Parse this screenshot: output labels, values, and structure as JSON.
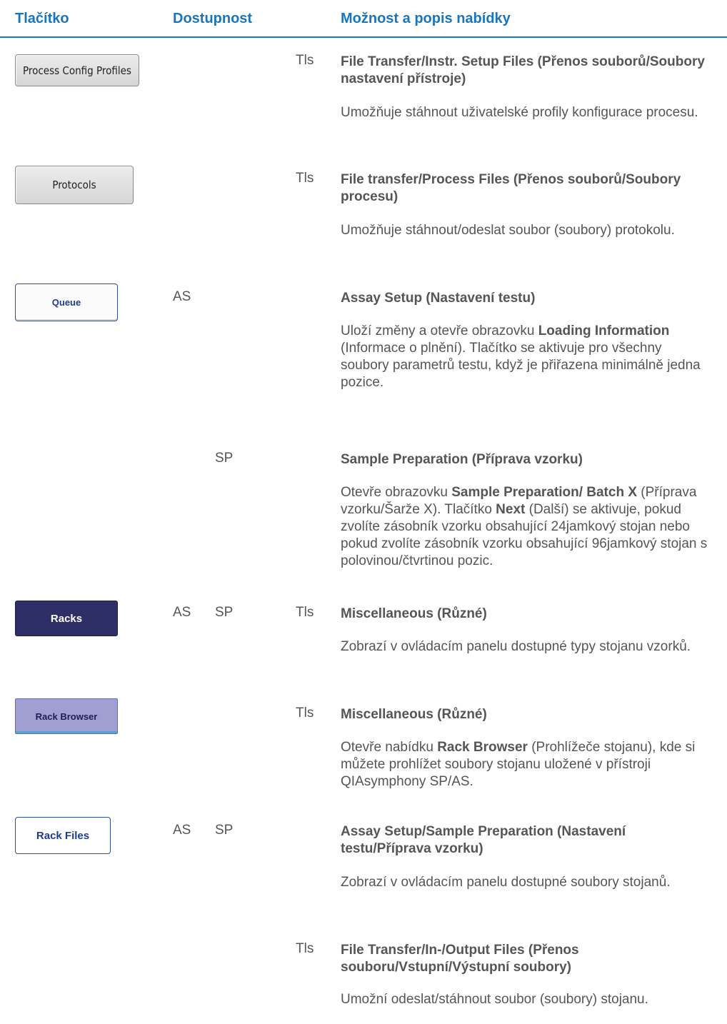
{
  "header": {
    "col_button": "Tlačítko",
    "col_availability": "Dostupnost",
    "col_description": "Možnost a popis nabídky"
  },
  "colors": {
    "accent": "#1a75bc",
    "text": "#555555"
  },
  "entries": [
    {
      "button_label": "Process Config Profiles",
      "button_style": "gray",
      "as": "",
      "sp": "",
      "tls": "Tls",
      "title": "File Transfer/Instr. Setup Files (Přenos souborů/Soubory nastavení přístroje)",
      "description": "Umožňuje stáhnout uživatelské profily konfigurace procesu."
    },
    {
      "button_label": "Protocols",
      "button_style": "gray",
      "as": "",
      "sp": "",
      "tls": "Tls",
      "title": "File transfer/Process Files (Přenos souborů/Soubory procesu)",
      "description": "Umožňuje stáhnout/odeslat soubor (soubory) protokolu."
    },
    {
      "button_label": "Queue",
      "button_style": "white-blue",
      "as": "AS",
      "sp": "",
      "tls": "",
      "title": "Assay Setup (Nastavení testu)",
      "description_parts": [
        "Uloží změny a otevře obrazovku ",
        "Loading Information",
        " (Informace o plnění). Tlačítko se aktivuje pro všechny soubory parametrů testu, když je přiřazena minimálně jedna pozice."
      ]
    },
    {
      "button_label": "",
      "as": "",
      "sp": "SP",
      "tls": "",
      "title": "Sample Preparation (Příprava vzorku)",
      "description_parts": [
        "Otevře obrazovku ",
        "Sample Preparation/ Batch X",
        " (Příprava vzorku/Šarže X). Tlačítko ",
        "Next",
        " (Další) se aktivuje, pokud zvolíte zásobník vzorku obsahující 24jamkový stojan nebo pokud zvolíte zásobník vzorku obsahující 96jamkový stojan s polovinou/čtvrtinou pozic."
      ]
    },
    {
      "button_label": "Racks",
      "button_style": "navy",
      "as": "AS",
      "sp": "SP",
      "tls": "Tls",
      "title": "Miscellaneous (Různé)",
      "description": "Zobrazí v ovládacím panelu dostupné typy stojanu vzorků."
    },
    {
      "button_label": "Rack Browser",
      "button_style": "lavender",
      "as": "",
      "sp": "",
      "tls": "Tls",
      "title": "Miscellaneous (Různé)",
      "description_parts": [
        "Otevře nabídku ",
        "Rack Browser",
        " (Prohlížeče stojanu), kde si můžete prohlížet soubory stojanu uložené v přístroji QIAsymphony SP/AS."
      ]
    },
    {
      "button_label": "Rack Files",
      "button_style": "outline-blue",
      "as": "AS",
      "sp": "SP",
      "tls": "",
      "title": "Assay Setup/Sample Preparation (Nastavení testu/Příprava vzorku)",
      "description": "Zobrazí v ovládacím panelu dostupné soubory stojanů."
    },
    {
      "button_label": "",
      "as": "",
      "sp": "",
      "tls": "Tls",
      "title": "File Transfer/In-/Output Files (Přenos souboru/Vstupní/Výstupní soubory)",
      "description": "Umožní odeslat/stáhnout soubor (soubory) stojanu."
    }
  ]
}
